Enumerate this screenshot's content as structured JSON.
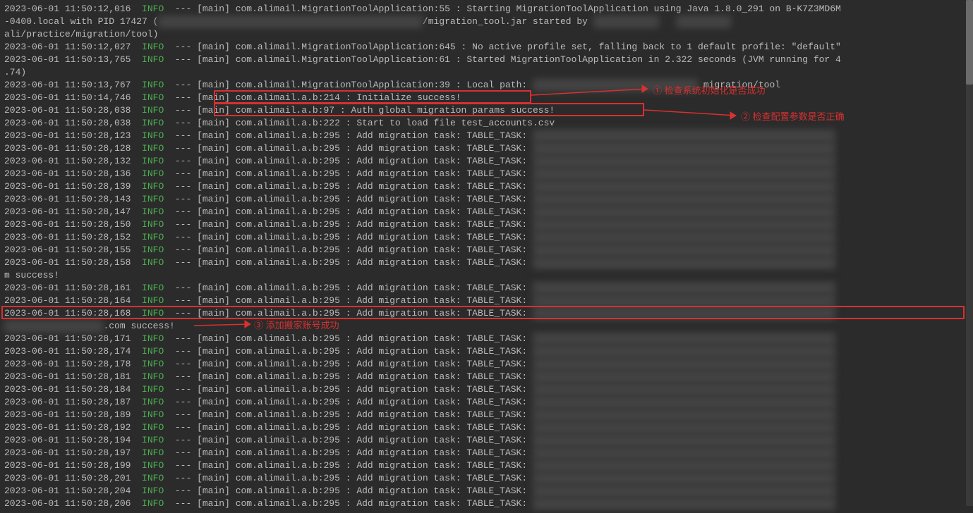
{
  "annotations": {
    "a1": "① 检查系统初始化是否成功",
    "a2": "② 检查配置参数是否正确",
    "a3": "③ 添加搬家账号成功"
  },
  "continuation_suffix": "ali/practice/migration/tool)",
  "continuation_seconds": ".74)",
  "success_suffix": ".com success!",
  "m_success": "m success!",
  "lines": [
    {
      "ts": "2023-06-01 11:50:12,016",
      "lvl": "INFO",
      "thr": "[main]",
      "cls": "com.alimail.MigrationToolApplication:55",
      "msg": ": Starting MigrationToolApplication using Java 1.8.0_291 on B-K7Z3MD6M"
    },
    {
      "raw_start": "-0400.local with PID 17427 (",
      "raw_end": "/migration_tool.jar started by"
    },
    {
      "ts": "2023-06-01 11:50:12,027",
      "lvl": "INFO",
      "thr": "[main]",
      "cls": "com.alimail.MigrationToolApplication:645",
      "msg": ": No active profile set, falling back to 1 default profile: \"default\""
    },
    {
      "ts": "2023-06-01 11:50:13,765",
      "lvl": "INFO",
      "thr": "[main]",
      "cls": "com.alimail.MigrationToolApplication:61",
      "msg": ": Started MigrationToolApplication in 2.322 seconds (JVM running for 4"
    },
    {
      "ts": "2023-06-01 11:50:13,767",
      "lvl": "INFO",
      "thr": "[main]",
      "cls": "com.alimail.MigrationToolApplication:39",
      "msg": ": Local path:",
      "tail": "migration/tool"
    },
    {
      "ts": "2023-06-01 11:50:14,746",
      "lvl": "INFO",
      "thr": "[main]",
      "cls": "com.alimail.a.b:214",
      "msg": ": Initialize success!"
    },
    {
      "ts": "2023-06-01 11:50:28,038",
      "lvl": "INFO",
      "thr": "[main]",
      "cls": "com.alimail.a.b:97",
      "msg": ": Auth global migration params success!"
    },
    {
      "ts": "2023-06-01 11:50:28,038",
      "lvl": "INFO",
      "thr": "[main]",
      "cls": "com.alimail.a.b:222",
      "msg": ": Start to load file test_accounts.csv"
    },
    {
      "ts": "2023-06-01 11:50:28,123",
      "lvl": "INFO",
      "thr": "[main]",
      "cls": "com.alimail.a.b:295",
      "msg": ": Add migration task: TABLE_TASK:",
      "blur": true
    },
    {
      "ts": "2023-06-01 11:50:28,128",
      "lvl": "INFO",
      "thr": "[main]",
      "cls": "com.alimail.a.b:295",
      "msg": ": Add migration task: TABLE_TASK:",
      "blur": true
    },
    {
      "ts": "2023-06-01 11:50:28,132",
      "lvl": "INFO",
      "thr": "[main]",
      "cls": "com.alimail.a.b:295",
      "msg": ": Add migration task: TABLE_TASK:",
      "blur": true
    },
    {
      "ts": "2023-06-01 11:50:28,136",
      "lvl": "INFO",
      "thr": "[main]",
      "cls": "com.alimail.a.b:295",
      "msg": ": Add migration task: TABLE_TASK:",
      "blur": true
    },
    {
      "ts": "2023-06-01 11:50:28,139",
      "lvl": "INFO",
      "thr": "[main]",
      "cls": "com.alimail.a.b:295",
      "msg": ": Add migration task: TABLE_TASK:",
      "blur": true
    },
    {
      "ts": "2023-06-01 11:50:28,143",
      "lvl": "INFO",
      "thr": "[main]",
      "cls": "com.alimail.a.b:295",
      "msg": ": Add migration task: TABLE_TASK:",
      "blur": true
    },
    {
      "ts": "2023-06-01 11:50:28,147",
      "lvl": "INFO",
      "thr": "[main]",
      "cls": "com.alimail.a.b:295",
      "msg": ": Add migration task: TABLE_TASK:",
      "blur": true
    },
    {
      "ts": "2023-06-01 11:50:28,150",
      "lvl": "INFO",
      "thr": "[main]",
      "cls": "com.alimail.a.b:295",
      "msg": ": Add migration task: TABLE_TASK:",
      "blur": true
    },
    {
      "ts": "2023-06-01 11:50:28,152",
      "lvl": "INFO",
      "thr": "[main]",
      "cls": "com.alimail.a.b:295",
      "msg": ": Add migration task: TABLE_TASK:",
      "blur": true
    },
    {
      "ts": "2023-06-01 11:50:28,155",
      "lvl": "INFO",
      "thr": "[main]",
      "cls": "com.alimail.a.b:295",
      "msg": ": Add migration task: TABLE_TASK:",
      "blur": true
    },
    {
      "ts": "2023-06-01 11:50:28,158",
      "lvl": "INFO",
      "thr": "[main]",
      "cls": "com.alimail.a.b:295",
      "msg": ": Add migration task: TABLE_TASK:",
      "blur": true
    },
    {
      "ts": "2023-06-01 11:50:28,161",
      "lvl": "INFO",
      "thr": "[main]",
      "cls": "com.alimail.a.b:295",
      "msg": ": Add migration task: TABLE_TASK:",
      "blur": true
    },
    {
      "ts": "2023-06-01 11:50:28,164",
      "lvl": "INFO",
      "thr": "[main]",
      "cls": "com.alimail.a.b:295",
      "msg": ": Add migration task: TABLE_TASK:",
      "blur": true
    },
    {
      "ts": "2023-06-01 11:50:28,168",
      "lvl": "INFO",
      "thr": "[main]",
      "cls": "com.alimail.a.b:295",
      "msg": ": Add migration task: TABLE_TASK:",
      "blur": true
    },
    {
      "ts": "2023-06-01 11:50:28,171",
      "lvl": "INFO",
      "thr": "[main]",
      "cls": "com.alimail.a.b:295",
      "msg": ": Add migration task: TABLE_TASK:",
      "blur": true
    },
    {
      "ts": "2023-06-01 11:50:28,174",
      "lvl": "INFO",
      "thr": "[main]",
      "cls": "com.alimail.a.b:295",
      "msg": ": Add migration task: TABLE_TASK:",
      "blur": true
    },
    {
      "ts": "2023-06-01 11:50:28,178",
      "lvl": "INFO",
      "thr": "[main]",
      "cls": "com.alimail.a.b:295",
      "msg": ": Add migration task: TABLE_TASK:",
      "blur": true
    },
    {
      "ts": "2023-06-01 11:50:28,181",
      "lvl": "INFO",
      "thr": "[main]",
      "cls": "com.alimail.a.b:295",
      "msg": ": Add migration task: TABLE_TASK:",
      "blur": true
    },
    {
      "ts": "2023-06-01 11:50:28,184",
      "lvl": "INFO",
      "thr": "[main]",
      "cls": "com.alimail.a.b:295",
      "msg": ": Add migration task: TABLE_TASK:",
      "blur": true
    },
    {
      "ts": "2023-06-01 11:50:28,187",
      "lvl": "INFO",
      "thr": "[main]",
      "cls": "com.alimail.a.b:295",
      "msg": ": Add migration task: TABLE_TASK:",
      "blur": true
    },
    {
      "ts": "2023-06-01 11:50:28,189",
      "lvl": "INFO",
      "thr": "[main]",
      "cls": "com.alimail.a.b:295",
      "msg": ": Add migration task: TABLE_TASK:",
      "blur": true
    },
    {
      "ts": "2023-06-01 11:50:28,192",
      "lvl": "INFO",
      "thr": "[main]",
      "cls": "com.alimail.a.b:295",
      "msg": ": Add migration task: TABLE_TASK:",
      "blur": true
    },
    {
      "ts": "2023-06-01 11:50:28,194",
      "lvl": "INFO",
      "thr": "[main]",
      "cls": "com.alimail.a.b:295",
      "msg": ": Add migration task: TABLE_TASK:",
      "blur": true
    },
    {
      "ts": "2023-06-01 11:50:28,197",
      "lvl": "INFO",
      "thr": "[main]",
      "cls": "com.alimail.a.b:295",
      "msg": ": Add migration task: TABLE_TASK:",
      "blur": true
    },
    {
      "ts": "2023-06-01 11:50:28,199",
      "lvl": "INFO",
      "thr": "[main]",
      "cls": "com.alimail.a.b:295",
      "msg": ": Add migration task: TABLE_TASK:",
      "blur": true
    },
    {
      "ts": "2023-06-01 11:50:28,201",
      "lvl": "INFO",
      "thr": "[main]",
      "cls": "com.alimail.a.b:295",
      "msg": ": Add migration task: TABLE_TASK:",
      "blur": true
    },
    {
      "ts": "2023-06-01 11:50:28,204",
      "lvl": "INFO",
      "thr": "[main]",
      "cls": "com.alimail.a.b:295",
      "msg": ": Add migration task: TABLE_TASK:",
      "blur": true
    },
    {
      "ts": "2023-06-01 11:50:28,206",
      "lvl": "INFO",
      "thr": "[main]",
      "cls": "com.alimail.a.b:295",
      "msg": ": Add migration task: TABLE_TASK:",
      "blur": true
    }
  ]
}
